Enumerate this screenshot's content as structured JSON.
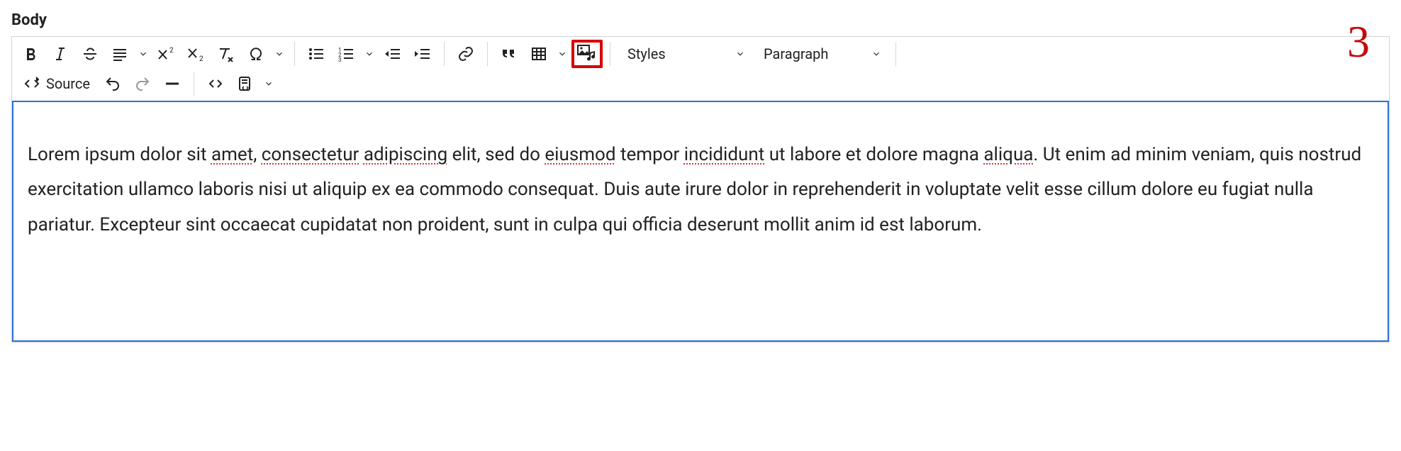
{
  "field_label": "Body",
  "annotation_number": "3",
  "toolbar": {
    "source_label": "Source",
    "styles_label": "Styles",
    "format_label": "Paragraph"
  },
  "content": {
    "p1_1": "Lorem ipsum dolor sit ",
    "p1_w_amet": "amet",
    "p1_2": ", ",
    "p1_w_consectetur": "consectetur",
    "p1_3": " ",
    "p1_w_adipiscing": "adipiscing",
    "p1_4": " elit, sed do ",
    "p1_w_eiusmod": "eiusmod",
    "p1_5": " tempor ",
    "p1_w_incididunt": "incididunt",
    "p1_6": " ut labore et dolore magna ",
    "p1_w_aliqua": "aliqua",
    "p1_7": ". Ut enim ad minim veniam, quis nostrud exercitation ullamco laboris nisi ut aliquip ex ea commodo consequat. Duis aute irure dolor in reprehenderit in voluptate velit esse cillum dolore eu fugiat nulla pariatur. Excepteur sint occaecat cupidatat non proident, sunt in culpa qui officia deserunt mollit anim id est laborum."
  }
}
